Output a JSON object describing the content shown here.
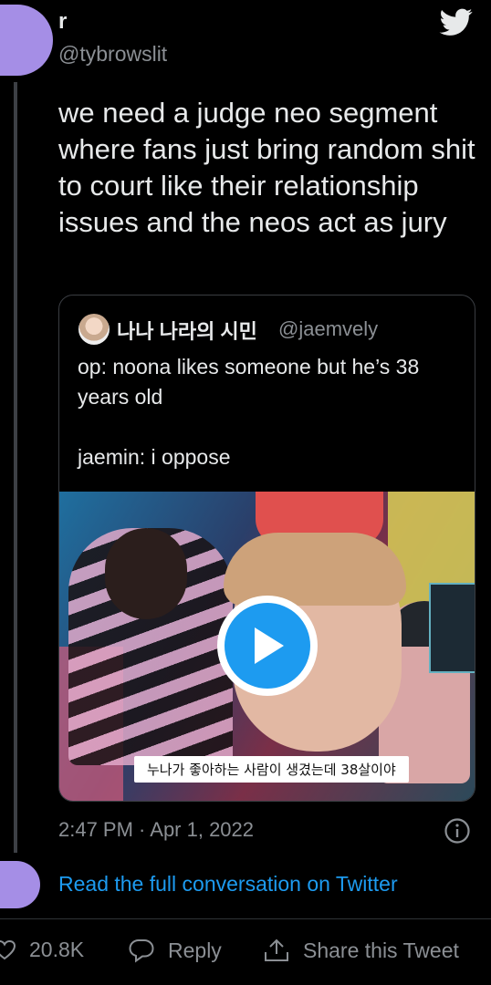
{
  "tweet": {
    "display_name": "r",
    "handle": "@tybrowslit",
    "text": "we need a judge neo segment where fans just bring random shit to court like their relationship issues and the neos act as jury",
    "timestamp": "2:47 PM · Apr 1, 2022"
  },
  "quote": {
    "display_name": "나나 나라의 시민",
    "handle": "@jaemvely",
    "text": "op: noona likes someone but he’s 38 years old\n\njaemin: i oppose",
    "media_subtitle": "누나가 좋아하는 사람이 생겼는데 38살이야"
  },
  "footer": {
    "read_link": "Read the full conversation on Twitter",
    "likes": "20.8K",
    "reply_label": "Reply",
    "share_label": "Share this Tweet"
  },
  "colors": {
    "background": "#000000",
    "accent": "#1d9bf0",
    "muted_text": "#8b8f94",
    "avatar": "#a58ee6"
  },
  "icons": [
    "twitter-bird-icon",
    "play-icon",
    "info-icon",
    "heart-icon",
    "reply-bubble-icon",
    "share-icon"
  ]
}
